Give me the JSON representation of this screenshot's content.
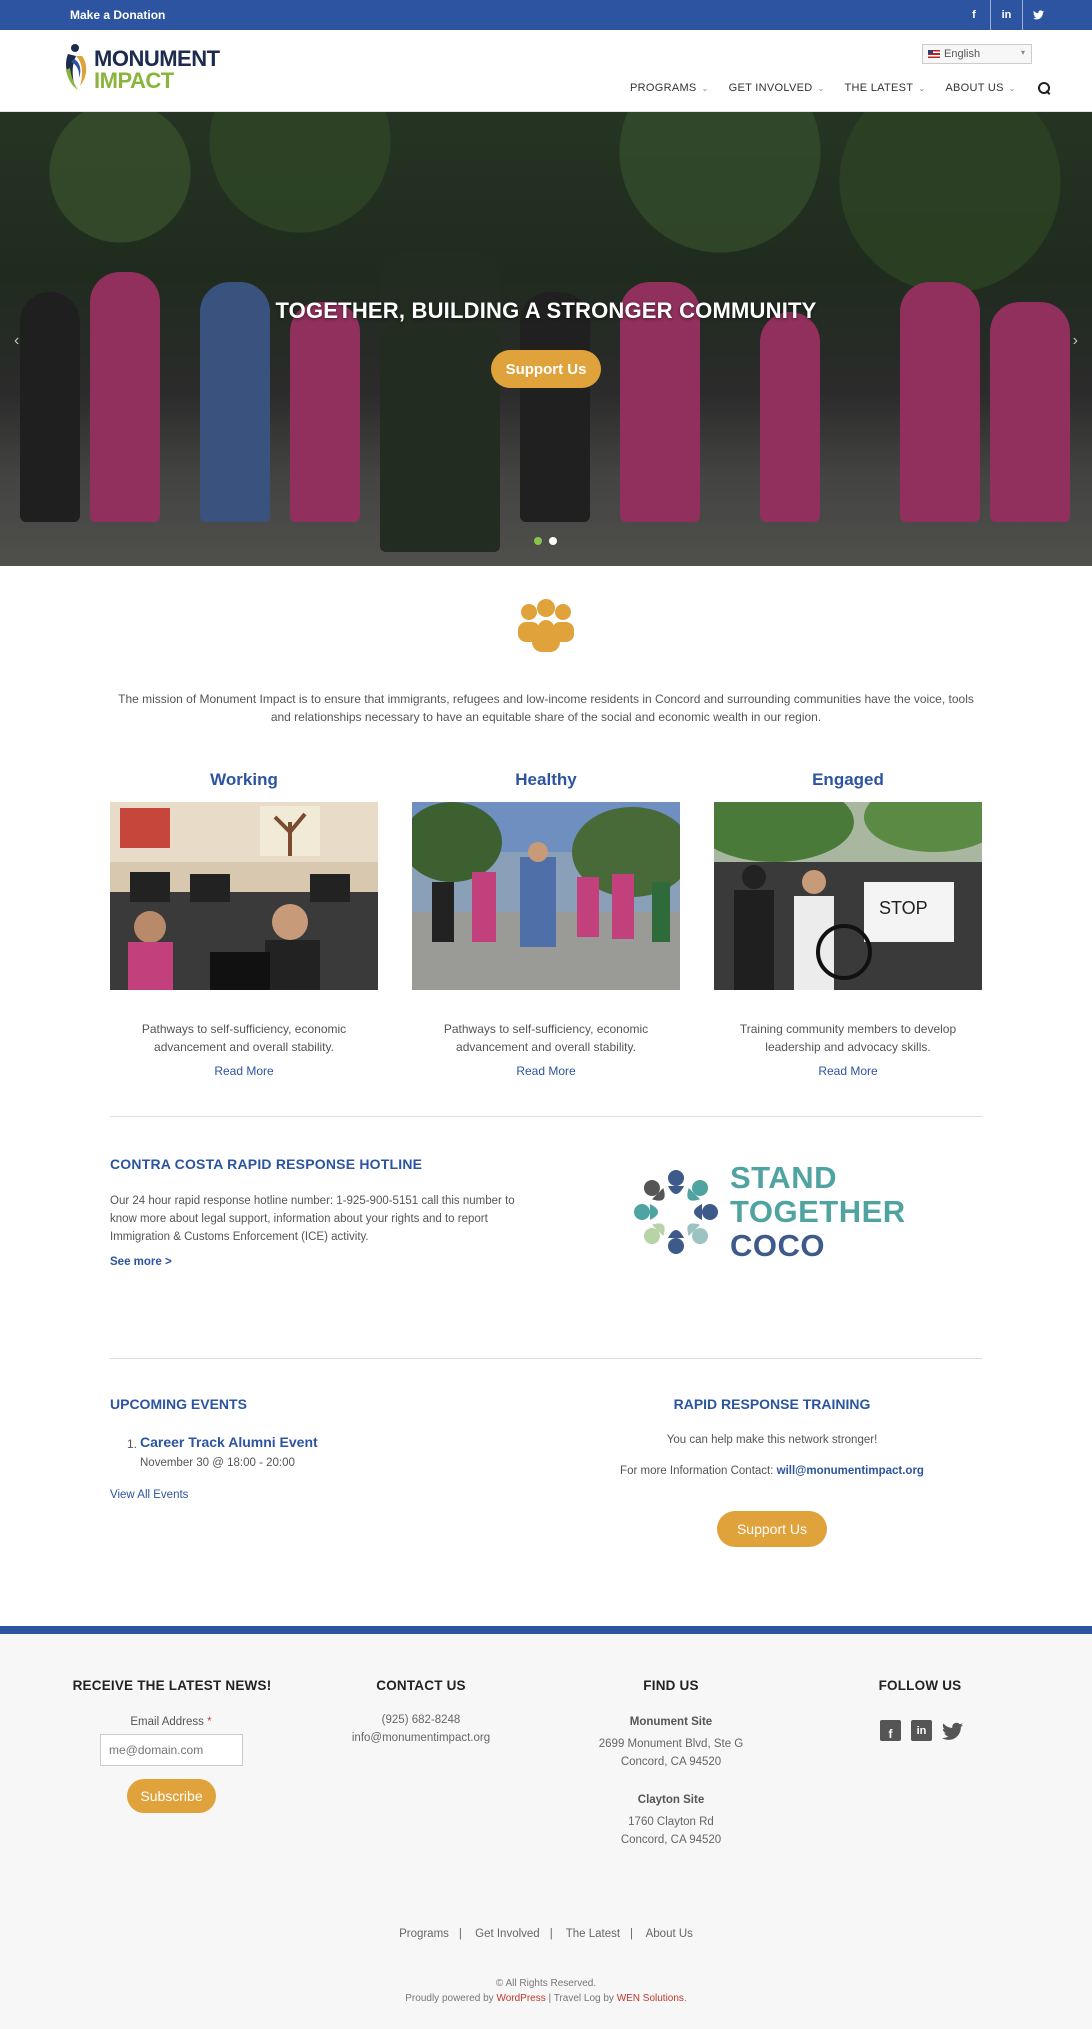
{
  "topbar": {
    "donate": "Make a Donation",
    "social": {
      "facebook": "f",
      "linkedin": "in",
      "twitter": "🐦"
    }
  },
  "header": {
    "logo_line1": "MONUMENT",
    "logo_line2": "IMPACT",
    "language": "English",
    "nav": [
      "PROGRAMS",
      "GET INVOLVED",
      "THE LATEST",
      "ABOUT US"
    ]
  },
  "hero": {
    "title": "TOGETHER, BUILDING A STRONGER COMMUNITY",
    "button": "Support Us"
  },
  "mission": {
    "text": "The mission of Monument Impact is to ensure that immigrants, refugees and low-income residents in Concord and surrounding communities have the voice, tools and relationships necessary to have an equitable share of the social and economic wealth in our region."
  },
  "columns": [
    {
      "title": "Working",
      "desc": "Pathways to self-sufficiency, economic advancement and overall stability.",
      "link": "Read More"
    },
    {
      "title": "Healthy",
      "desc": "Pathways to self-sufficiency, economic advancement and overall stability.",
      "link": "Read More"
    },
    {
      "title": "Engaged",
      "desc": "Training community members to develop leadership and advocacy skills.",
      "link": "Read More"
    }
  ],
  "hotline": {
    "title": "CONTRA COSTA RAPID RESPONSE HOTLINE",
    "text": "Our 24 hour rapid response hotline number: 1-925-900-5151 call this number to know more about legal support, information about your rights and to report Immigration & Customs Enforcement (ICE) activity.",
    "link": "See more >",
    "logo_lines": [
      "STAND",
      "TOGETHER",
      "COCO"
    ]
  },
  "events": {
    "title": "UPCOMING EVENTS",
    "num": "1.",
    "name": "Career Track Alumni Event",
    "date": "November 30 @ 18:00 - 20:00",
    "link": "View All Events"
  },
  "training": {
    "title": "RAPID RESPONSE TRAINING",
    "line1": "You can help make this network stronger!",
    "line2_prefix": "For more Information Contact: ",
    "email": "will@monumentimpact.org",
    "button": "Support Us"
  },
  "footer": {
    "news_title": "RECEIVE THE LATEST NEWS!",
    "email_label": "Email Address",
    "email_req": "*",
    "email_placeholder": "me@domain.com",
    "subscribe": "Subscribe",
    "contact_title": "CONTACT US",
    "phone": "(925) 682-8248",
    "email": "info@monumentimpact.org",
    "find_title": "FIND US",
    "site1_name": "Monument Site",
    "site1_addr1": "2699 Monument Blvd, Ste G",
    "site1_addr2": "Concord, CA 94520",
    "site2_name": "Clayton Site",
    "site2_addr1": "1760 Clayton Rd",
    "site2_addr2": "Concord, CA 94520",
    "follow_title": "FOLLOW US",
    "nav": [
      "Programs",
      "Get Involved",
      "The Latest",
      "About Us"
    ],
    "nav_sep": "|",
    "copyright": "© All Rights Reserved.",
    "powered_prefix": "Proudly powered by ",
    "powered_wp": "WordPress",
    "powered_mid": " | Travel Log by ",
    "powered_wen": "WEN Solutions",
    "powered_end": "."
  },
  "colors": {
    "brand_blue": "#2d54a0",
    "accent_gold": "#e0a23a",
    "logo_green": "#8bb43d",
    "teal": "#4fa3a1",
    "navy": "#3d5a8a"
  }
}
